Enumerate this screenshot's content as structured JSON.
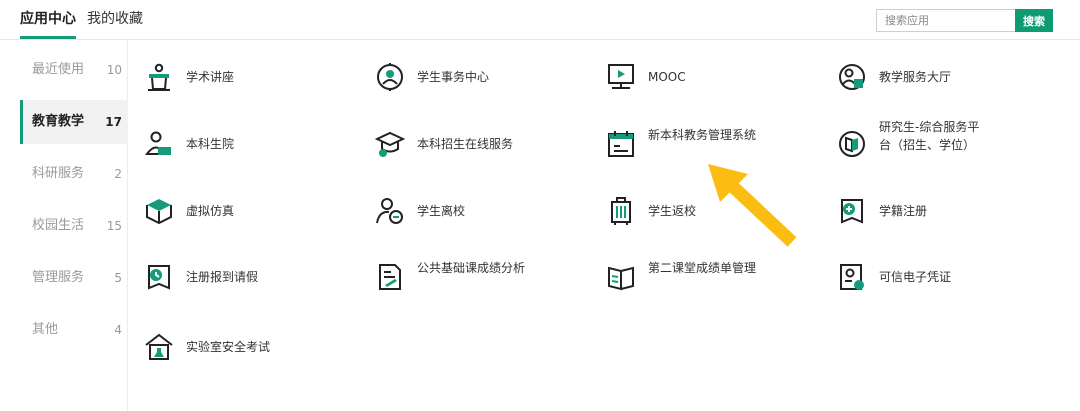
{
  "tabs": {
    "app_center": "应用中心",
    "favorites": "我的收藏"
  },
  "search": {
    "placeholder": "搜索应用",
    "button_label": "搜索"
  },
  "sidebar": {
    "items": [
      {
        "label": "最近使用",
        "count": "10"
      },
      {
        "label": "教育教学",
        "count": "17"
      },
      {
        "label": "科研服务",
        "count": "2"
      },
      {
        "label": "校园生活",
        "count": "15"
      },
      {
        "label": "管理服务",
        "count": "5"
      },
      {
        "label": "其他",
        "count": "4"
      }
    ],
    "active_index": 1
  },
  "apps": [
    {
      "label": "学术讲座",
      "icon": "lecture-podium-icon"
    },
    {
      "label": "学生事务中心",
      "icon": "student-affairs-icon"
    },
    {
      "label": "MOOC",
      "icon": "mooc-screen-icon"
    },
    {
      "label": "教学服务大厅",
      "icon": "teaching-service-icon"
    },
    {
      "label": "本科生院",
      "icon": "undergraduate-icon"
    },
    {
      "label": "本科招生在线服务",
      "icon": "graduation-cap-icon"
    },
    {
      "label": "新本科教务管理系统",
      "icon": "calendar-icon"
    },
    {
      "label": "研究生-综合服务平台（招生、学位）",
      "icon": "book-circle-icon"
    },
    {
      "label": "虚拟仿真",
      "icon": "cube-icon"
    },
    {
      "label": "学生离校",
      "icon": "user-minus-icon"
    },
    {
      "label": "学生返校",
      "icon": "luggage-icon"
    },
    {
      "label": "学籍注册",
      "icon": "register-book-icon"
    },
    {
      "label": "注册报到请假",
      "icon": "leave-book-icon"
    },
    {
      "label": "公共基础课成绩分析",
      "icon": "grade-document-icon"
    },
    {
      "label": "第二课堂成绩单管理",
      "icon": "open-book-icon"
    },
    {
      "label": "可信电子凭证",
      "icon": "certificate-icon"
    },
    {
      "label": "实验室安全考试",
      "icon": "lab-house-icon"
    }
  ],
  "colors": {
    "accent": "#169b7a",
    "button": "#0e9b72",
    "arrow": "#fbbd12"
  }
}
